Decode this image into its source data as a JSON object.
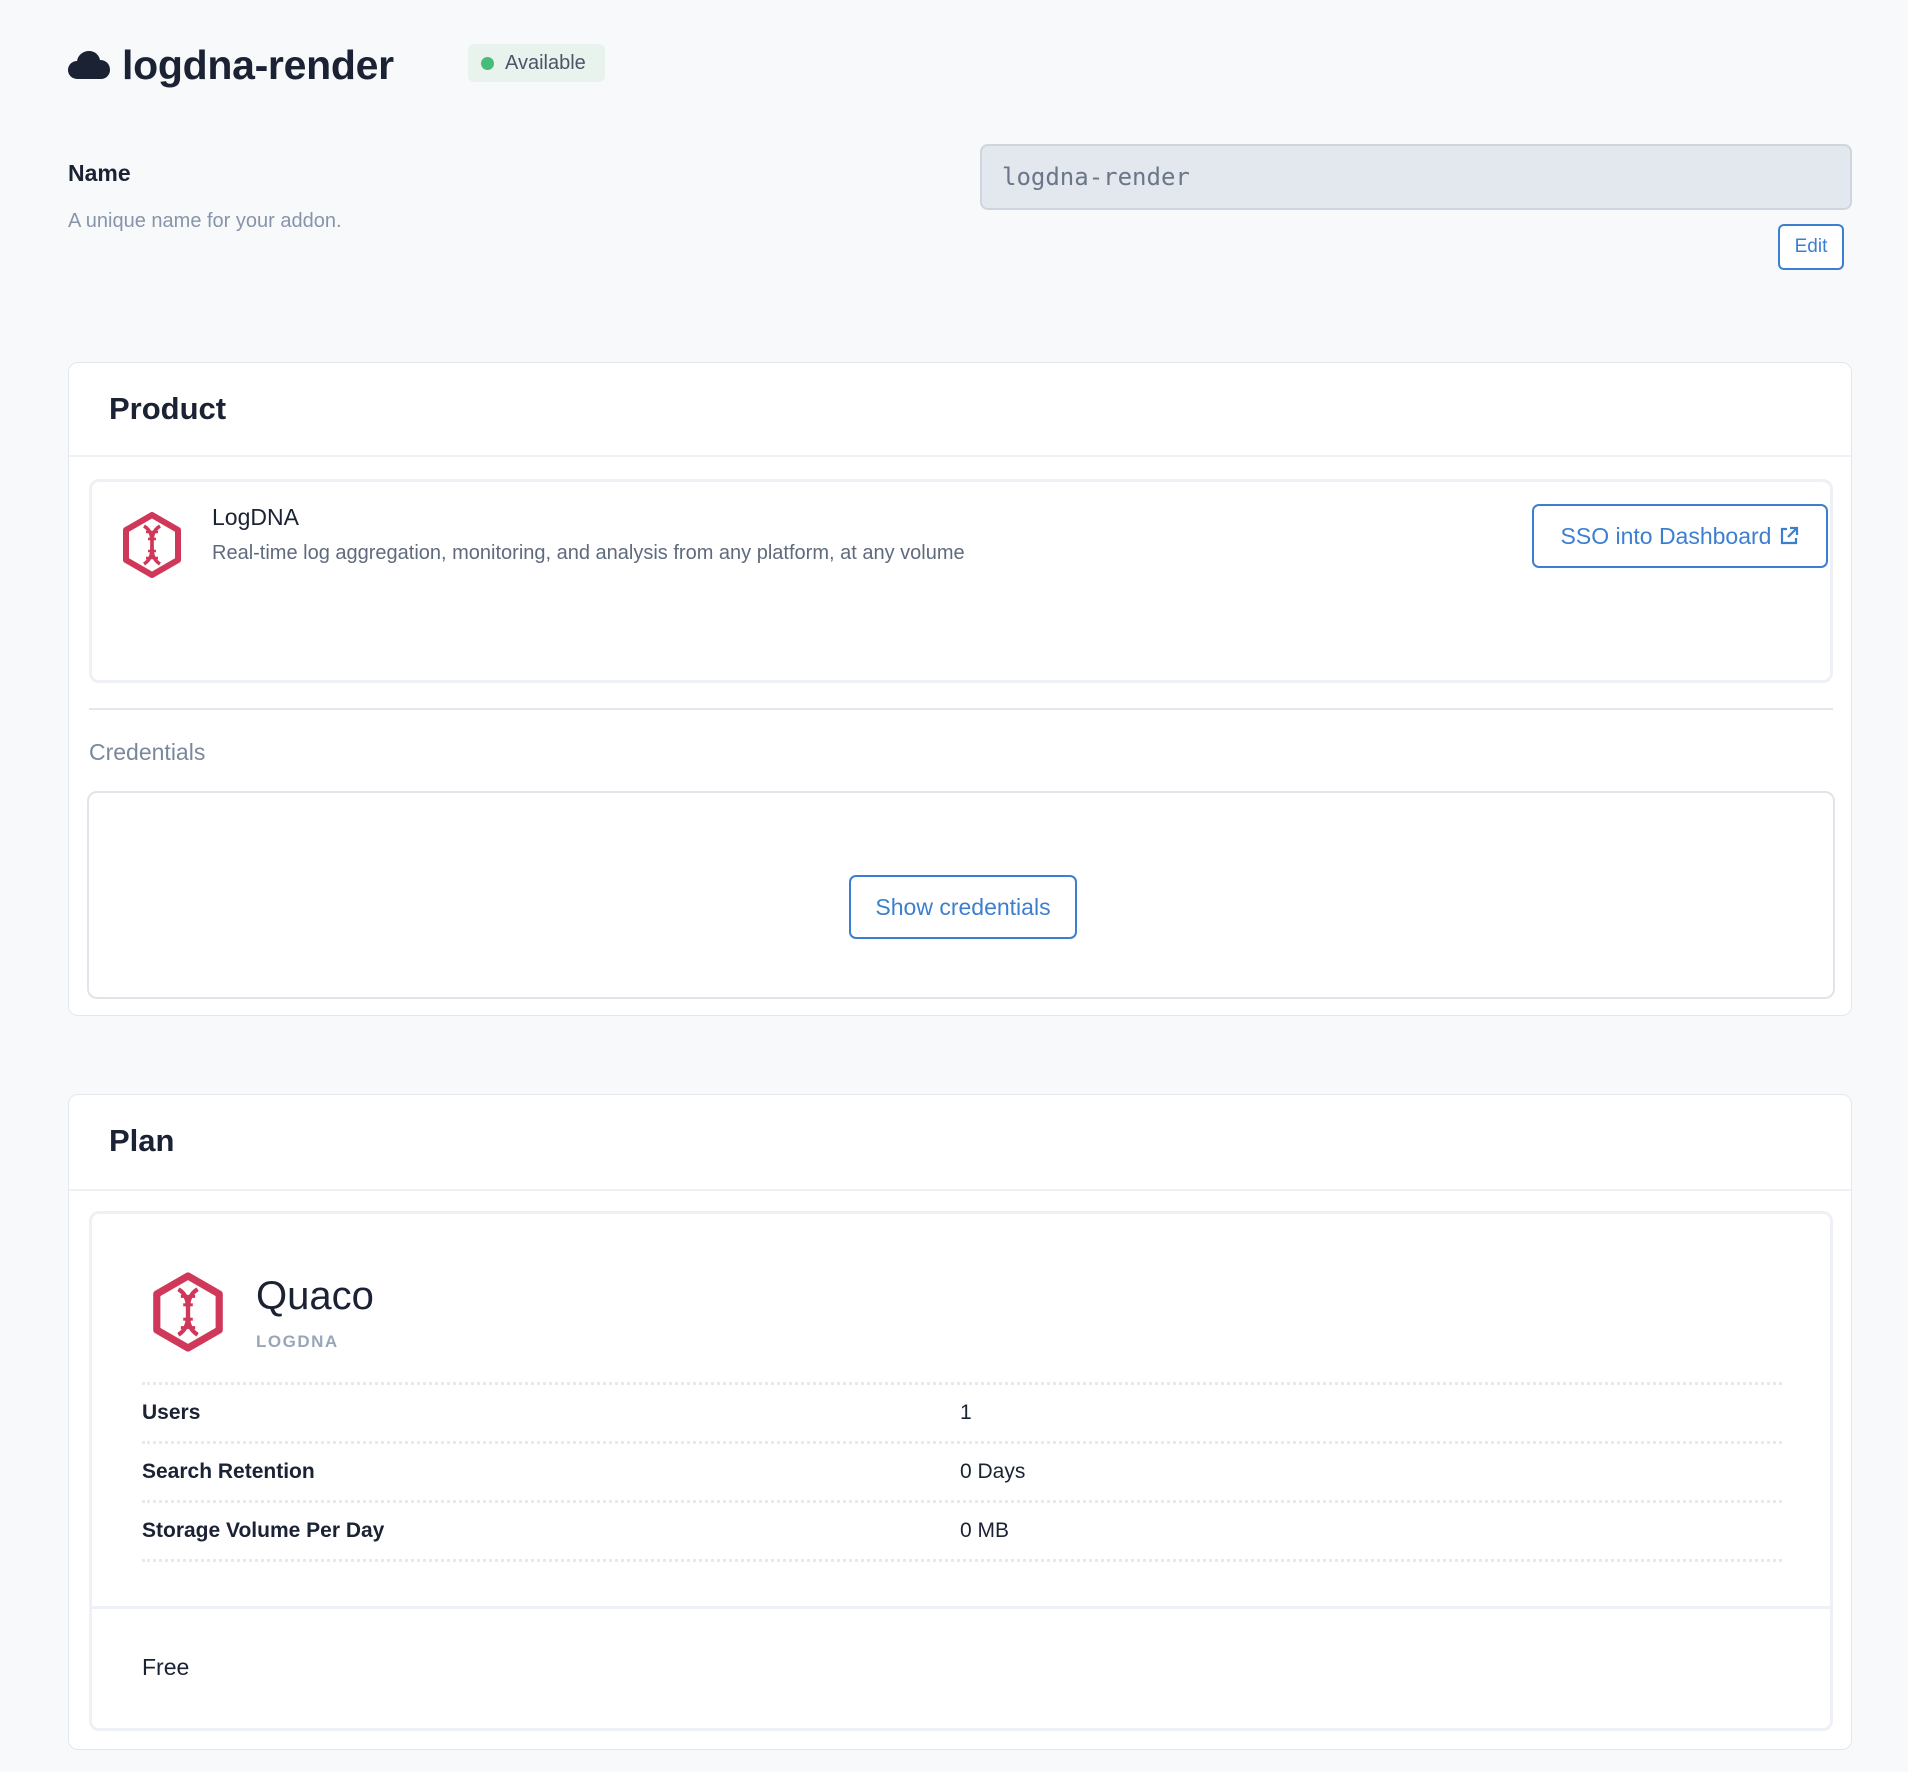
{
  "header": {
    "title": "logdna-render",
    "icon": "cloud-icon",
    "status": "Available",
    "status_color": "#48bb78"
  },
  "name_field": {
    "label": "Name",
    "help": "A unique name for your addon.",
    "value": "logdna-render",
    "edit_label": "Edit"
  },
  "product": {
    "section_title": "Product",
    "name": "LogDNA",
    "description": "Real-time log aggregation, monitoring, and analysis from any platform, at any volume",
    "icon": "logdna-icon",
    "sso_label": "SSO into Dashboard",
    "credentials_label": "Credentials",
    "show_credentials_label": "Show credentials"
  },
  "plan": {
    "section_title": "Plan",
    "name": "Quaco",
    "vendor": "LOGDNA",
    "rows": [
      {
        "label": "Users",
        "value": "1"
      },
      {
        "label": "Search Retention",
        "value": "0 Days"
      },
      {
        "label": "Storage Volume Per Day",
        "value": "0 MB"
      }
    ],
    "price": "Free"
  },
  "colors": {
    "accent": "#3c7fd1",
    "brand": "#d0385a"
  }
}
